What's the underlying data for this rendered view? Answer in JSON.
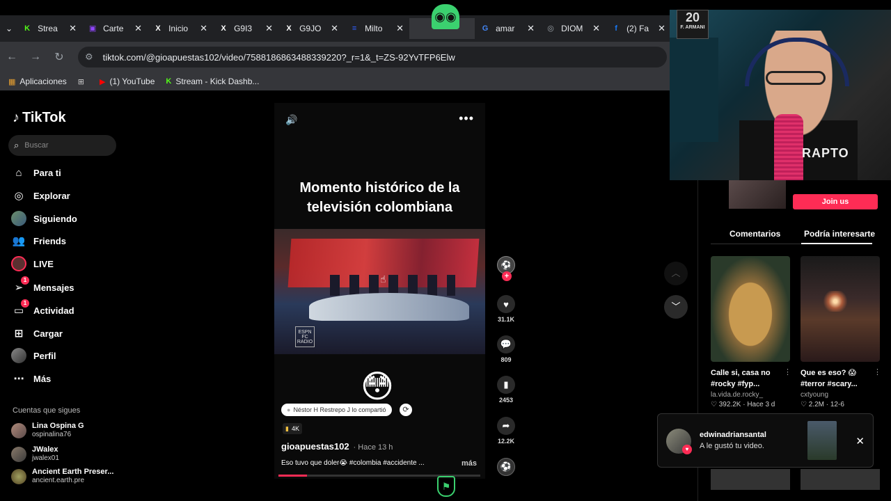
{
  "browser": {
    "tabs": [
      {
        "label": "Strea",
        "icon": "kick-icon",
        "color": "#53fc18",
        "glyph": "K"
      },
      {
        "label": "Carte",
        "icon": "twitch-icon",
        "color": "#9146ff",
        "glyph": "▣"
      },
      {
        "label": "Inicio",
        "icon": "x-icon",
        "color": "#ffffff",
        "glyph": "X"
      },
      {
        "label": "G9I3",
        "icon": "x-icon",
        "color": "#ffffff",
        "glyph": "X"
      },
      {
        "label": "G9JO",
        "icon": "x-icon",
        "color": "#ffffff",
        "glyph": "X"
      },
      {
        "label": "Milto",
        "icon": "site-icon",
        "color": "#3060ff",
        "glyph": "≡"
      },
      {
        "label": "",
        "icon": "active-tab",
        "color": "#ffffff",
        "glyph": ""
      },
      {
        "label": "amar",
        "icon": "google-icon",
        "color": "#4285f4",
        "glyph": "G"
      },
      {
        "label": "DIOM",
        "icon": "globe-icon",
        "color": "#9aa0a6",
        "glyph": "◎"
      },
      {
        "label": "(2) Fa",
        "icon": "facebook-icon",
        "color": "#1877f2",
        "glyph": "f"
      }
    ],
    "url": "tiktok.com/@gioapuestas102/video/7588186863488339220?_r=1&_t=ZS-92YvTFP6Elw",
    "bookmarks": {
      "apps": "Aplicaciones",
      "youtube": "(1) YouTube",
      "kick": "Stream - Kick Dashb..."
    }
  },
  "sidebar": {
    "logo": "TikTok",
    "search_placeholder": "Buscar",
    "nav": {
      "for_you": "Para ti",
      "explore": "Explorar",
      "following": "Siguiendo",
      "friends": "Friends",
      "live": "LIVE",
      "messages": "Mensajes",
      "messages_badge": "1",
      "activity": "Actividad",
      "activity_badge": "1",
      "upload": "Cargar",
      "profile": "Perfil",
      "more": "Más"
    },
    "following_title": "Cuentas que sigues",
    "accounts": [
      {
        "name": "Lina Ospina G",
        "handle": "ospinalina76"
      },
      {
        "name": "JWalex",
        "handle": "jwalex01"
      },
      {
        "name": "Ancient Earth Preser...",
        "handle": "ancient.earth.pre"
      }
    ]
  },
  "video": {
    "headline_line1": "Momento histórico de la",
    "headline_line2": "televisión colombiana",
    "clip_logo": "ESPN FC RADIO",
    "emoji": "😳",
    "shared_by": "Néstor H Restrepo J lo compartió",
    "views": "4K",
    "author": "gioapuestas102",
    "time": "· Hace 13 h",
    "caption": "Eso tuvo que doler😭 #colombia #accidente ...",
    "more": "más",
    "progress": 0.14
  },
  "actions": {
    "likes": "31.1K",
    "comments": "809",
    "saves": "2453",
    "shares": "12.2K"
  },
  "right_panel": {
    "join": "Join us",
    "tab_comments": "Comentarios",
    "tab_interest": "Podría interesarte",
    "recs": [
      {
        "title": "Calle si, casa no #rocky #fyp...",
        "author": "la.vida.de.rocky_",
        "stats": "♡ 392.2K · Hace 3 d"
      },
      {
        "title": "Que es eso? 😱 #terror #scary...",
        "author": "cxtyoung",
        "stats": "♡ 2.2M · 12-6"
      }
    ]
  },
  "toast": {
    "user": "edwinadriansantal",
    "message": "A le gustó tu video."
  },
  "webcam": {
    "jersey_number": "20",
    "jersey_name": "F. ARMANI",
    "shirt_text": "RAPTO"
  }
}
